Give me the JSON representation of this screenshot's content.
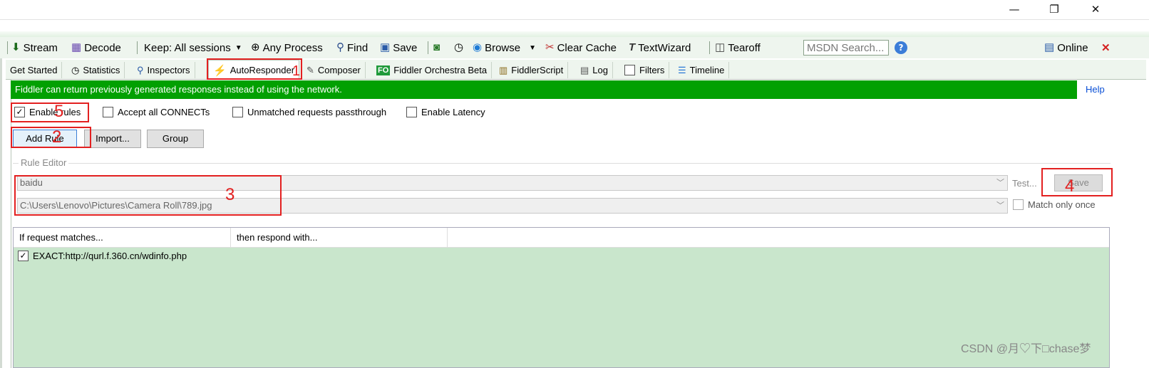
{
  "window": {
    "minimize": "—",
    "restore": "❐",
    "close": "✕"
  },
  "toolbar": {
    "stream": "Stream",
    "decode": "Decode",
    "keep": "Keep: All sessions",
    "any_process": "Any Process",
    "find": "Find",
    "save": "Save",
    "browse": "Browse",
    "clear_cache": "Clear Cache",
    "textwizard": "TextWizard",
    "tearoff": "Tearoff",
    "msdn_search": "MSDN Search...",
    "online": "Online"
  },
  "tabs": [
    {
      "label": "Get Started"
    },
    {
      "label": "Statistics"
    },
    {
      "label": "Inspectors"
    },
    {
      "label": "AutoResponder"
    },
    {
      "label": "Composer"
    },
    {
      "label": "Fiddler Orchestra Beta",
      "badge": "FO"
    },
    {
      "label": "FiddlerScript"
    },
    {
      "label": "Log"
    },
    {
      "label": "Filters"
    },
    {
      "label": "Timeline"
    }
  ],
  "autoresponder": {
    "banner": "Fiddler can return previously generated responses instead of using the network.",
    "help": "Help",
    "options": {
      "enable_rules": "Enable rules",
      "accept_connects": "Accept all CONNECTs",
      "unmatched_passthrough": "Unmatched requests passthrough",
      "enable_latency": "Enable Latency"
    },
    "buttons": {
      "add_rule": "Add Rule",
      "import": "Import...",
      "group": "Group"
    },
    "rule_editor": {
      "label": "Rule Editor",
      "match_value": "baidu",
      "respond_value": "C:\\Users\\Lenovo\\Pictures\\Camera Roll\\789.jpg",
      "test": "Test...",
      "save": "Save",
      "match_only_once": "Match only once"
    },
    "table": {
      "col_match": "If request matches...",
      "col_respond": "then respond with...",
      "rows": [
        {
          "match": "EXACT:http://qurl.f.360.cn/wdinfo.php"
        }
      ]
    }
  },
  "annotations": {
    "n1": "1",
    "n2": "2",
    "n3": "3",
    "n4": "4",
    "n5": "5"
  },
  "watermark": "CSDN @月♡下□chase梦",
  "colors": {
    "banner": "#02a002",
    "annotation": "#e32020",
    "rules_bg": "#c9e6cc"
  }
}
